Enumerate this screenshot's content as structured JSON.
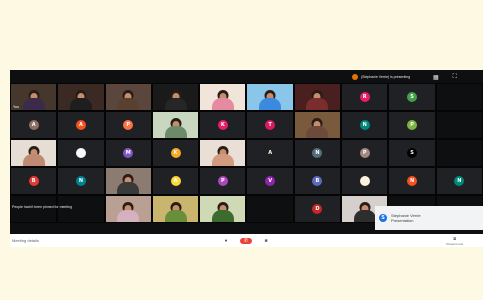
{
  "top_bar": {
    "presenter_text": "(Stephanie Verrie) is presenting",
    "layout_icon": "layout-icon",
    "fullscreen_icon": "fullscreen-icon"
  },
  "presenter_tile": {
    "avatar_color": "#1a73e8",
    "avatar_letter": "S",
    "name": "Stephanie Verrie",
    "status": "Presentation"
  },
  "pinned_snippet": "People hadn't been pinned for meeting",
  "controls": {
    "meeting_details": "Meeting details",
    "mic_icon": "mic-icon",
    "end_call_icon": "end-call-icon",
    "camera_icon": "camera-icon",
    "present_label": "Present now"
  },
  "tiles": [
    {
      "type": "video",
      "torso": "#3c2a4a",
      "bg": "#46372d",
      "label": "You"
    },
    {
      "type": "video",
      "torso": "#1e1e1e",
      "bg": "#3b2a24"
    },
    {
      "type": "video",
      "torso": "#5a4030",
      "bg": "#5b463d"
    },
    {
      "type": "video",
      "torso": "#262626",
      "bg": "#1a1a1a"
    },
    {
      "type": "video",
      "torso": "#e58aa0",
      "bg": "#f0e5d8"
    },
    {
      "type": "video",
      "torso": "#3c8adf",
      "bg": "#8ac6ea"
    },
    {
      "type": "video",
      "torso": "#7b2d2d",
      "bg": "#4a1f1f"
    },
    {
      "type": "avatar",
      "color": "#e91e63",
      "letter": "R"
    },
    {
      "type": "avatar",
      "color": "#43a047",
      "letter": "S"
    },
    {
      "type": "empty"
    },
    {
      "type": "avatar",
      "color": "#8d6e63",
      "letter": "A"
    },
    {
      "type": "avatar",
      "color": "#f4511e",
      "letter": "A"
    },
    {
      "type": "avatar",
      "color": "#ff7043",
      "letter": "P"
    },
    {
      "type": "video",
      "torso": "#6d8a6a",
      "bg": "#c9d6c0"
    },
    {
      "type": "avatar",
      "color": "#e91e63",
      "letter": "K"
    },
    {
      "type": "avatar",
      "color": "#d81b60",
      "letter": "T"
    },
    {
      "type": "video",
      "torso": "#6d4a3a",
      "bg": "#7a5a3d"
    },
    {
      "type": "avatar",
      "color": "#00897b",
      "letter": "N"
    },
    {
      "type": "avatar",
      "color": "#7cb342",
      "letter": "P"
    },
    {
      "type": "empty"
    },
    {
      "type": "video",
      "torso": "#c08a72",
      "bg": "#e6ddd4"
    },
    {
      "type": "avatar",
      "color": "#fafafa",
      "letter": " "
    },
    {
      "type": "avatar",
      "color": "#7e57c2",
      "letter": "M"
    },
    {
      "type": "avatar",
      "color": "#f9a825",
      "letter": "K"
    },
    {
      "type": "video",
      "torso": "#d29a7f",
      "bg": "#e9dfd6"
    },
    {
      "type": "avatar",
      "color": "#212121",
      "letter": "A"
    },
    {
      "type": "avatar",
      "color": "#546e7a",
      "letter": "N"
    },
    {
      "type": "avatar",
      "color": "#a1887f",
      "letter": "P"
    },
    {
      "type": "avatar",
      "color": "#000000",
      "letter": "S"
    },
    {
      "type": "empty"
    },
    {
      "type": "avatar",
      "color": "#e53935",
      "letter": "B"
    },
    {
      "type": "avatar",
      "color": "#00838f",
      "letter": "N"
    },
    {
      "type": "video",
      "torso": "#3a3a3a",
      "bg": "#8b7b70"
    },
    {
      "type": "avatar",
      "color": "#fdd835",
      "letter": "A"
    },
    {
      "type": "avatar",
      "color": "#ab47bc",
      "letter": "P"
    },
    {
      "type": "avatar",
      "color": "#8e24aa",
      "letter": "V"
    },
    {
      "type": "avatar",
      "color": "#5c6bc0",
      "letter": "B"
    },
    {
      "type": "avatar",
      "color": "#fff3e0",
      "letter": " "
    },
    {
      "type": "avatar",
      "color": "#f4511e",
      "letter": "N"
    },
    {
      "type": "avatar",
      "color": "#00897b",
      "letter": "N"
    },
    {
      "type": "empty"
    },
    {
      "type": "empty"
    },
    {
      "type": "video",
      "torso": "#d4b0c0",
      "bg": "#b9a093"
    },
    {
      "type": "video",
      "torso": "#6b8e3a",
      "bg": "#c9b56e"
    },
    {
      "type": "video",
      "torso": "#3d6b2d",
      "bg": "#cfd9b6"
    },
    {
      "type": "empty"
    },
    {
      "type": "avatar",
      "color": "#c62828",
      "letter": "D"
    },
    {
      "type": "video",
      "torso": "#2e2e2e",
      "bg": "#d5d0cc"
    },
    {
      "type": "empty"
    },
    {
      "type": "empty"
    }
  ]
}
